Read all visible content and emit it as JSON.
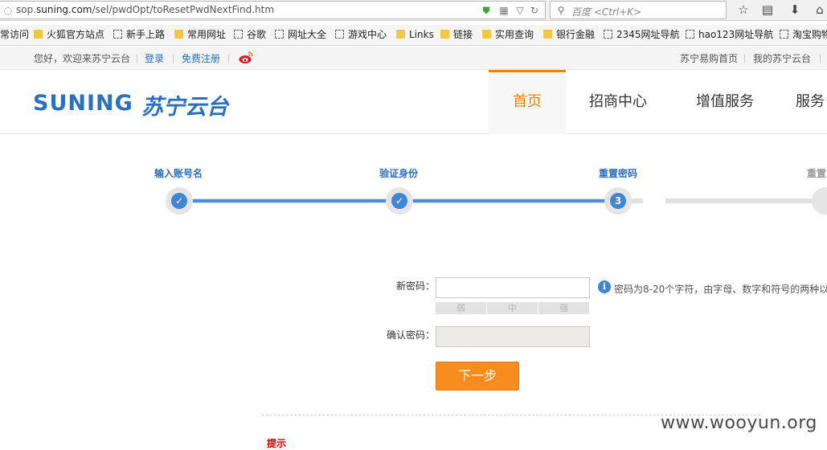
{
  "browser": {
    "url_prefix": "sop.",
    "url_domain": "suning.com",
    "url_path": "/sel/pwdOpt/toResetPwdNextFind.htm",
    "search_placeholder": "百度 <Ctrl+K>",
    "icons": [
      "shield-icon",
      "qr-code-icon",
      "dropdown-icon",
      "reload-icon",
      "search-icon",
      "star-icon",
      "clipboard-icon",
      "download-icon",
      "home-icon"
    ]
  },
  "bookmarks": [
    {
      "label": "常访问",
      "icon": "none"
    },
    {
      "label": "火狐官方站点",
      "icon": "folder"
    },
    {
      "label": "新手上路",
      "icon": "page"
    },
    {
      "label": "常用网址",
      "icon": "folder"
    },
    {
      "label": "谷歌",
      "icon": "page"
    },
    {
      "label": "网址大全",
      "icon": "page"
    },
    {
      "label": "游戏中心",
      "icon": "page"
    },
    {
      "label": "Links",
      "icon": "folder"
    },
    {
      "label": "链接",
      "icon": "folder"
    },
    {
      "label": "实用查询",
      "icon": "folder"
    },
    {
      "label": "银行金融",
      "icon": "folder"
    },
    {
      "label": "2345网址导航",
      "icon": "page"
    },
    {
      "label": "hao123网址导航",
      "icon": "page"
    },
    {
      "label": "淘宝购物",
      "icon": "page"
    }
  ],
  "topbar": {
    "welcome": "您好，欢迎来苏宁云台",
    "login": "登录",
    "register": "免费注册",
    "weibo_icon": "weibo-icon",
    "right_links": [
      "苏宁易购首页",
      "我的苏宁云台"
    ]
  },
  "header": {
    "logo_en": "SUNING",
    "logo_cn": "苏宁云台",
    "nav": [
      "首页",
      "招商中心",
      "增值服务",
      "服务"
    ]
  },
  "steps": [
    {
      "label": "输入账号名",
      "state": "done"
    },
    {
      "label": "验证身份",
      "state": "done"
    },
    {
      "label": "重置密码",
      "state": "current",
      "number": "3"
    },
    {
      "label": "重置",
      "state": "todo"
    }
  ],
  "form": {
    "new_password_label": "新密码：",
    "new_password_value": "",
    "strength_levels": [
      "弱",
      "中",
      "强"
    ],
    "confirm_label": "确认密码：",
    "confirm_value": "",
    "hint": "密码为8-20个字符，由字母、数字和符号的两种以",
    "submit": "下一步"
  },
  "tips": {
    "title": "提示"
  },
  "watermark": "www.wooyun.org",
  "colors": {
    "accent_orange": "#f08300",
    "brand_blue": "#2b6fbf",
    "step_blue": "#3f86d8",
    "button_orange": "#f78c1f"
  }
}
